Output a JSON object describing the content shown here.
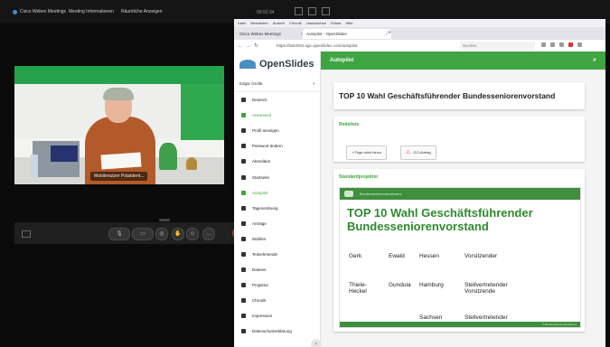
{
  "webex": {
    "top_items": [
      "Cisco Webex Meetings",
      "Meeting Informationen",
      "Räumliche Anzeigen"
    ],
    "clock": "00:52:34",
    "speaker_name": "Mobilenutzer Präsident..."
  },
  "browser": {
    "menubar": [
      "Datei",
      "Bearbeiten",
      "Ansicht",
      "Chronik",
      "Lesezeichen",
      "Extras",
      "Hilfe"
    ],
    "tabs": [
      {
        "label": "Cisco Webex Meetings"
      },
      {
        "label": "Autopilot - OpenSlides"
      }
    ],
    "tab_close": "×",
    "new_tab": "+",
    "url": "https://bvit2022.sgs.openslides.com/autopilot",
    "search_placeholder": "Suchen"
  },
  "openslides": {
    "logo": "OpenSlides",
    "user": "Edgar Grolle",
    "user_chevron": "›",
    "collapse_glyph": "‹",
    "nav": [
      {
        "label": "Deutsch",
        "active": false
      },
      {
        "label": "Anwesend",
        "active": true
      },
      {
        "label": "Profil anzeigen",
        "active": false
      },
      {
        "label": "Passwort ändern",
        "active": false
      },
      {
        "label": "Abmelden",
        "active": false
      },
      {
        "label": "Startseite",
        "active": false
      },
      {
        "label": "Autopilot",
        "active": true
      },
      {
        "label": "Tagesordnung",
        "active": false
      },
      {
        "label": "Anträge",
        "active": false
      },
      {
        "label": "Wahlen",
        "active": false
      },
      {
        "label": "Teilnehmende",
        "active": false
      },
      {
        "label": "Dateien",
        "active": false
      },
      {
        "label": "Projektor",
        "active": false
      },
      {
        "label": "Chronik",
        "active": false
      },
      {
        "label": "Impressum",
        "active": false
      },
      {
        "label": "Datenschutzerklärung",
        "active": false
      }
    ],
    "header": "Autopilot",
    "item_title": "TOP 10 Wahl Geschäftsführender Bundesseniorenvorstand",
    "speakers_heading": "Redeliste",
    "add_me_button": "+ Füge mich hinzu",
    "point_of_order_button": "GO-Antrag",
    "projector_heading": "Standardprojektor",
    "projector_header_text": "Bundesseniorenkonferenz",
    "projector_title": "TOP 10 Wahl Geschäftsführender Bundesseniorenvorstand",
    "projector_rows": [
      {
        "name": "Gerk",
        "first": "Ewald",
        "region": "Hessen",
        "role": "Vorsitzender"
      },
      {
        "name": "Thiele-Heckel",
        "first": "Gundula",
        "region": "Hamburg",
        "role": "Stellvertretender Vorsitzende"
      },
      {
        "name": "",
        "first": "",
        "region": "Sachsen",
        "role": "Stellvertretender"
      }
    ],
    "projector_footer": "© Bundesseniorenkonferenz"
  }
}
